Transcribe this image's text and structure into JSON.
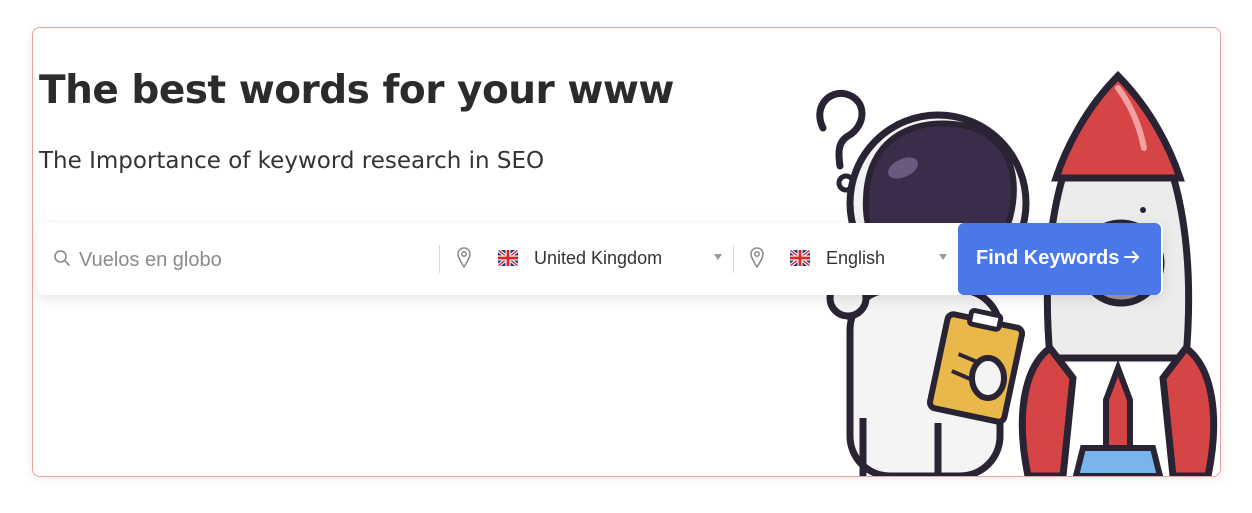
{
  "hero": {
    "title": "The best words for your www",
    "subtitle": "The Importance of keyword research in SEO"
  },
  "search": {
    "placeholder": "Vuelos en globo",
    "value": ""
  },
  "location": {
    "selected": "United Kingdom",
    "flag": "uk-flag-icon"
  },
  "language": {
    "selected": "English",
    "flag": "uk-flag-icon"
  },
  "actions": {
    "find_label": "Find Keywords"
  },
  "colors": {
    "accent": "#4a78e8",
    "card_border": "#e4a3a3",
    "text_dark": "#2b2b2b",
    "rocket_red": "#d64545"
  }
}
